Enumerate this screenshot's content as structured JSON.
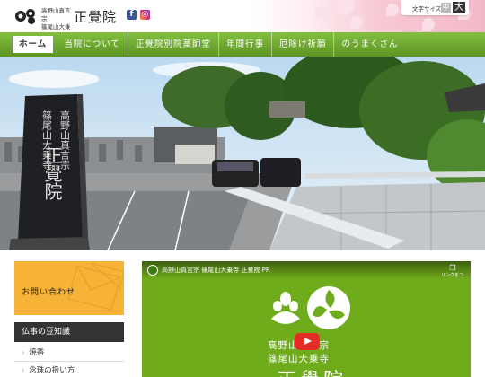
{
  "header": {
    "subtitle_line1": "高野山真言宗",
    "subtitle_line2": "篠尾山大乗寺",
    "brand": "正覺院",
    "social": [
      {
        "name": "facebook",
        "glyph": "f"
      },
      {
        "name": "instagram",
        "glyph": "◎"
      }
    ],
    "font_size": {
      "label": "文字サイズ",
      "medium": "中",
      "large": "大"
    }
  },
  "nav": {
    "items": [
      {
        "label": "ホーム",
        "active": true
      },
      {
        "label": "当院について",
        "active": false
      },
      {
        "label": "正覺院別院薬師堂",
        "active": false
      },
      {
        "label": "年間行事",
        "active": false
      },
      {
        "label": "厄除け祈願",
        "active": false
      },
      {
        "label": "のうまくさん",
        "active": false
      }
    ]
  },
  "hero": {
    "stone_text_right": "高野山真言宗",
    "stone_text_left": "篠尾山大乗寺",
    "stone_main": "正覺院"
  },
  "sidebar": {
    "contact_label": "お問い合わせ",
    "heading": "仏事の豆知識",
    "items": [
      "焼香",
      "念珠の扱い方"
    ]
  },
  "video": {
    "title": "高野山真言宗 篠尾山大乗寺 正覺院 PR",
    "share_label": "リンクをコ...",
    "line1": "高野山真言宗",
    "line2": "篠尾山大乗寺",
    "line3": "正覺院"
  },
  "colors": {
    "nav_green": "#6aa82c",
    "contact_orange": "#f7b338",
    "video_green": "#6fac1c",
    "sidebar_head": "#333333"
  }
}
